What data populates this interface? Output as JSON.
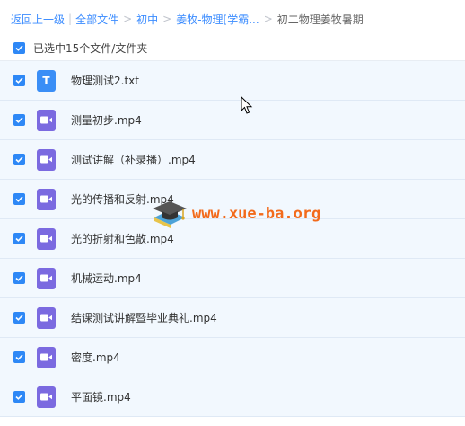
{
  "breadcrumb": {
    "back": "返回上一级",
    "all_files": "全部文件",
    "level1": "初中",
    "level2": "姜牧-物理[学霸...",
    "current": "初二物理姜牧暑期"
  },
  "selection": {
    "label": "已选中15个文件/文件夹"
  },
  "files": [
    {
      "name": "物理测试2.txt",
      "icon": "txt-file-icon"
    },
    {
      "name": "测量初步.mp4",
      "icon": "video-file-icon"
    },
    {
      "name": "测试讲解（补录播）.mp4",
      "icon": "video-file-icon"
    },
    {
      "name": "光的传播和反射.mp4",
      "icon": "video-file-icon"
    },
    {
      "name": "光的折射和色散.mp4",
      "icon": "video-file-icon"
    },
    {
      "name": "机械运动.mp4",
      "icon": "video-file-icon"
    },
    {
      "name": "结课测试讲解暨毕业典礼.mp4",
      "icon": "video-file-icon"
    },
    {
      "name": "密度.mp4",
      "icon": "video-file-icon"
    },
    {
      "name": "平面镜.mp4",
      "icon": "video-file-icon"
    }
  ],
  "watermark": {
    "text": "www.xue-ba.org"
  },
  "colors": {
    "link": "#3b8cff",
    "checkbox": "#2e88f6",
    "row_bg": "#f2f8fe",
    "txt_icon": "#3a8ef6",
    "video_icon": "#7b6ae0",
    "watermark": "#f26a1b"
  }
}
